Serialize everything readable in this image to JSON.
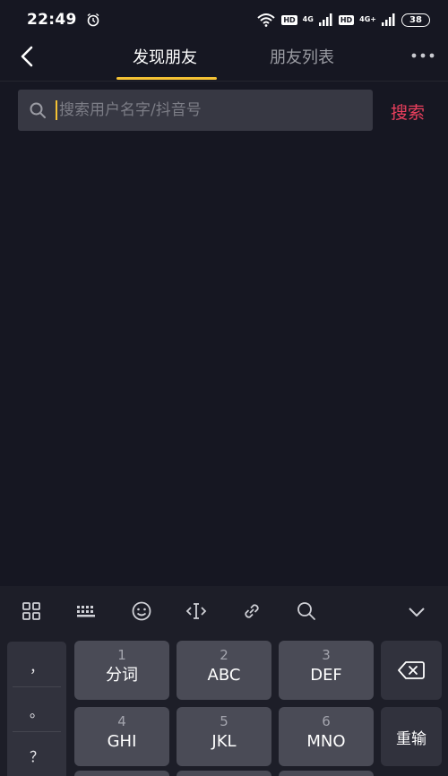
{
  "status_bar": {
    "time": "22:49",
    "hd_1": "HD",
    "net_1": "4G",
    "hd_2": "HD",
    "net_2": "4G+",
    "battery": "38"
  },
  "nav": {
    "tab_discover": "发现朋友",
    "tab_friends_list": "朋友列表"
  },
  "search": {
    "placeholder": "搜索用户名字/抖音号",
    "value": "",
    "action_label": "搜索"
  },
  "keyboard": {
    "side_keys": [
      "，",
      "。",
      "？"
    ],
    "keys": [
      {
        "num": "1",
        "label": "分词"
      },
      {
        "num": "2",
        "label": "ABC"
      },
      {
        "num": "3",
        "label": "DEF"
      },
      {
        "num": "4",
        "label": "GHI"
      },
      {
        "num": "5",
        "label": "JKL"
      },
      {
        "num": "6",
        "label": "MNO"
      }
    ],
    "retype_label": "重输"
  },
  "icons": {
    "toolbar": [
      "grid-icon",
      "keyboard-icon",
      "emoji-icon",
      "cursor-icon",
      "link-icon",
      "search-icon",
      "chevron-down-icon"
    ],
    "back": "back-arrow-icon",
    "more": "more-icon",
    "delete": "backspace-icon"
  },
  "colors": {
    "background": "#161722",
    "accent_yellow": "#f4c234",
    "search_red": "#ea3f5d",
    "input_bg": "#373843",
    "key_bg": "#4a4b56"
  }
}
